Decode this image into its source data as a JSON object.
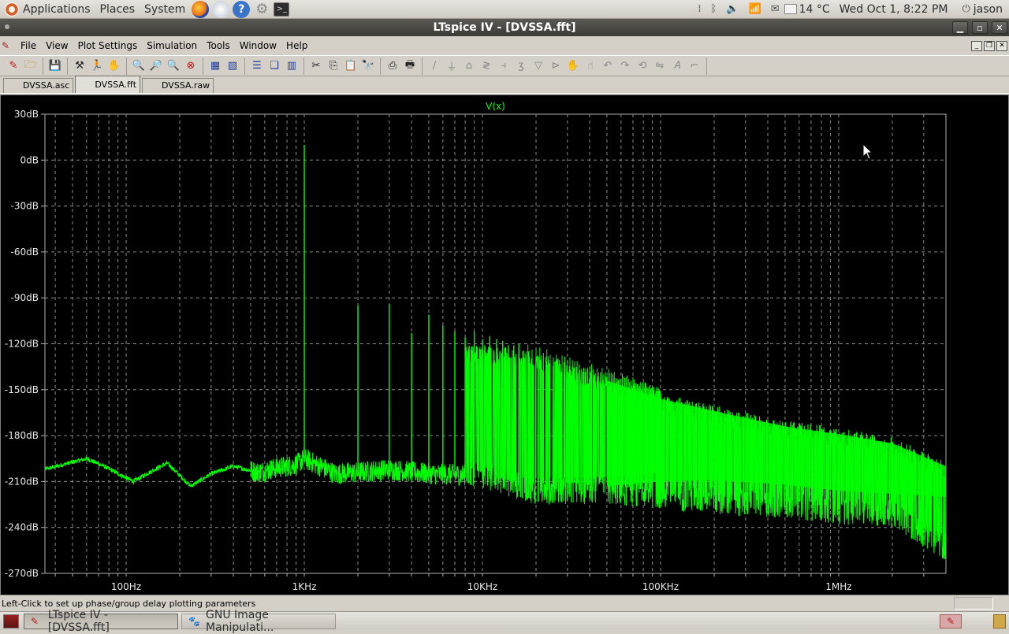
{
  "top_panel": {
    "menus": [
      "Applications",
      "Places",
      "System"
    ],
    "weather": "14 °C",
    "clock": "Wed Oct  1,  8:22 PM",
    "user": "jason"
  },
  "window": {
    "title": "LTspice IV - [DVSSA.fft]"
  },
  "menu_bar": {
    "items": [
      "File",
      "View",
      "Plot Settings",
      "Simulation",
      "Tools",
      "Window",
      "Help"
    ]
  },
  "toolbar": {
    "groups": [
      [
        "new-schematic-icon",
        "open-icon"
      ],
      [
        "save-icon"
      ],
      [
        "control-panel-icon",
        "run-icon",
        "halt-icon"
      ],
      [
        "zoom-in-icon",
        "zoom-box-icon",
        "zoom-out-icon",
        "zoom-full-icon"
      ],
      [
        "autorange-icon",
        "grid-icon"
      ],
      [
        "tile-horizontal-icon",
        "cascade-icon",
        "tile-vertical-icon"
      ],
      [
        "cut-icon",
        "copy-icon",
        "paste-icon",
        "find-icon"
      ],
      [
        "print-preview-icon",
        "print-icon"
      ],
      [
        "wire-icon",
        "ground-icon",
        "label-icon",
        "resistor-icon",
        "capacitor-icon",
        "inductor-icon",
        "diode-icon",
        "component-icon",
        "move-icon",
        "drag-icon",
        "undo-icon",
        "redo-icon",
        "rotate-icon",
        "mirror-icon",
        "text-icon",
        "spice-directive-icon"
      ]
    ]
  },
  "tabs": [
    "DVSSA.asc",
    "DVSSA.fft",
    "DVSSA.raw"
  ],
  "active_tab": "DVSSA.fft",
  "status_bar": {
    "text": "Left-Click to set up phase/group delay plotting parameters"
  },
  "taskbar": {
    "tasks": [
      "LTspice IV - [DVSSA.fft]",
      "GNU Image Manipulati..."
    ]
  },
  "colors": {
    "trace": "#00ff00",
    "plot_background": "#000000",
    "grid": "#8a8a8a"
  },
  "chart_data": {
    "type": "line",
    "title": "V(x)",
    "xscale": "log",
    "xlim": [
      35,
      4000000
    ],
    "ylim": [
      -270,
      30
    ],
    "ylabel_unit": "dB",
    "y_ticks": [
      "30dB",
      "0dB",
      "-30dB",
      "-60dB",
      "-90dB",
      "-120dB",
      "-150dB",
      "-180dB",
      "-210dB",
      "-240dB",
      "-270dB"
    ],
    "y_tick_values": [
      30,
      0,
      -30,
      -60,
      -90,
      -120,
      -150,
      -180,
      -210,
      -240,
      -270
    ],
    "x_ticks": [
      "100Hz",
      "1KHz",
      "10KHz",
      "100KHz",
      "1MHz"
    ],
    "x_tick_values": [
      100,
      1000,
      10000,
      100000,
      1000000
    ],
    "noise_floor": [
      [
        35,
        -202
      ],
      [
        60,
        -195
      ],
      [
        75,
        -200
      ],
      [
        110,
        -210
      ],
      [
        140,
        -203
      ],
      [
        170,
        -198
      ],
      [
        230,
        -213
      ],
      [
        300,
        -205
      ],
      [
        400,
        -200
      ],
      [
        550,
        -204
      ],
      [
        700,
        -201
      ],
      [
        900,
        -199
      ],
      [
        1000,
        -195
      ],
      [
        1500,
        -205
      ],
      [
        2000,
        -204
      ],
      [
        3000,
        -202
      ],
      [
        5000,
        -205
      ],
      [
        10000,
        -206
      ],
      [
        20000,
        -208
      ],
      [
        50000,
        -207
      ],
      [
        100000,
        -204
      ],
      [
        200000,
        -203
      ],
      [
        500000,
        -206
      ],
      [
        1000000,
        -210
      ],
      [
        2000000,
        -212
      ],
      [
        4000000,
        -214
      ]
    ],
    "envelope_top": [
      [
        10000,
        -120
      ],
      [
        20000,
        -125
      ],
      [
        50000,
        -140
      ],
      [
        100000,
        -152
      ],
      [
        200000,
        -160
      ],
      [
        500000,
        -170
      ],
      [
        1000000,
        -175
      ],
      [
        2000000,
        -181
      ],
      [
        4000000,
        -196
      ]
    ],
    "envelope_bottom": [
      [
        10000,
        -215
      ],
      [
        20000,
        -225
      ],
      [
        50000,
        -225
      ],
      [
        100000,
        -228
      ],
      [
        200000,
        -232
      ],
      [
        500000,
        -234
      ],
      [
        1000000,
        -238
      ],
      [
        2000000,
        -240
      ],
      [
        4000000,
        -262
      ]
    ],
    "harmonics": [
      {
        "f": 1000,
        "db": 10
      },
      {
        "f": 2000,
        "db": -95
      },
      {
        "f": 3000,
        "db": -94
      },
      {
        "f": 4000,
        "db": -113
      },
      {
        "f": 5000,
        "db": -101
      },
      {
        "f": 6000,
        "db": -108
      },
      {
        "f": 7000,
        "db": -112
      },
      {
        "f": 8000,
        "db": -116
      },
      {
        "f": 9000,
        "db": -112
      },
      {
        "f": 10000,
        "db": -117
      },
      {
        "f": 11000,
        "db": -115
      },
      {
        "f": 12000,
        "db": -117
      },
      {
        "f": 13000,
        "db": -118
      },
      {
        "f": 14000,
        "db": -121
      },
      {
        "f": 15000,
        "db": -121
      },
      {
        "f": 16000,
        "db": -120
      }
    ]
  }
}
